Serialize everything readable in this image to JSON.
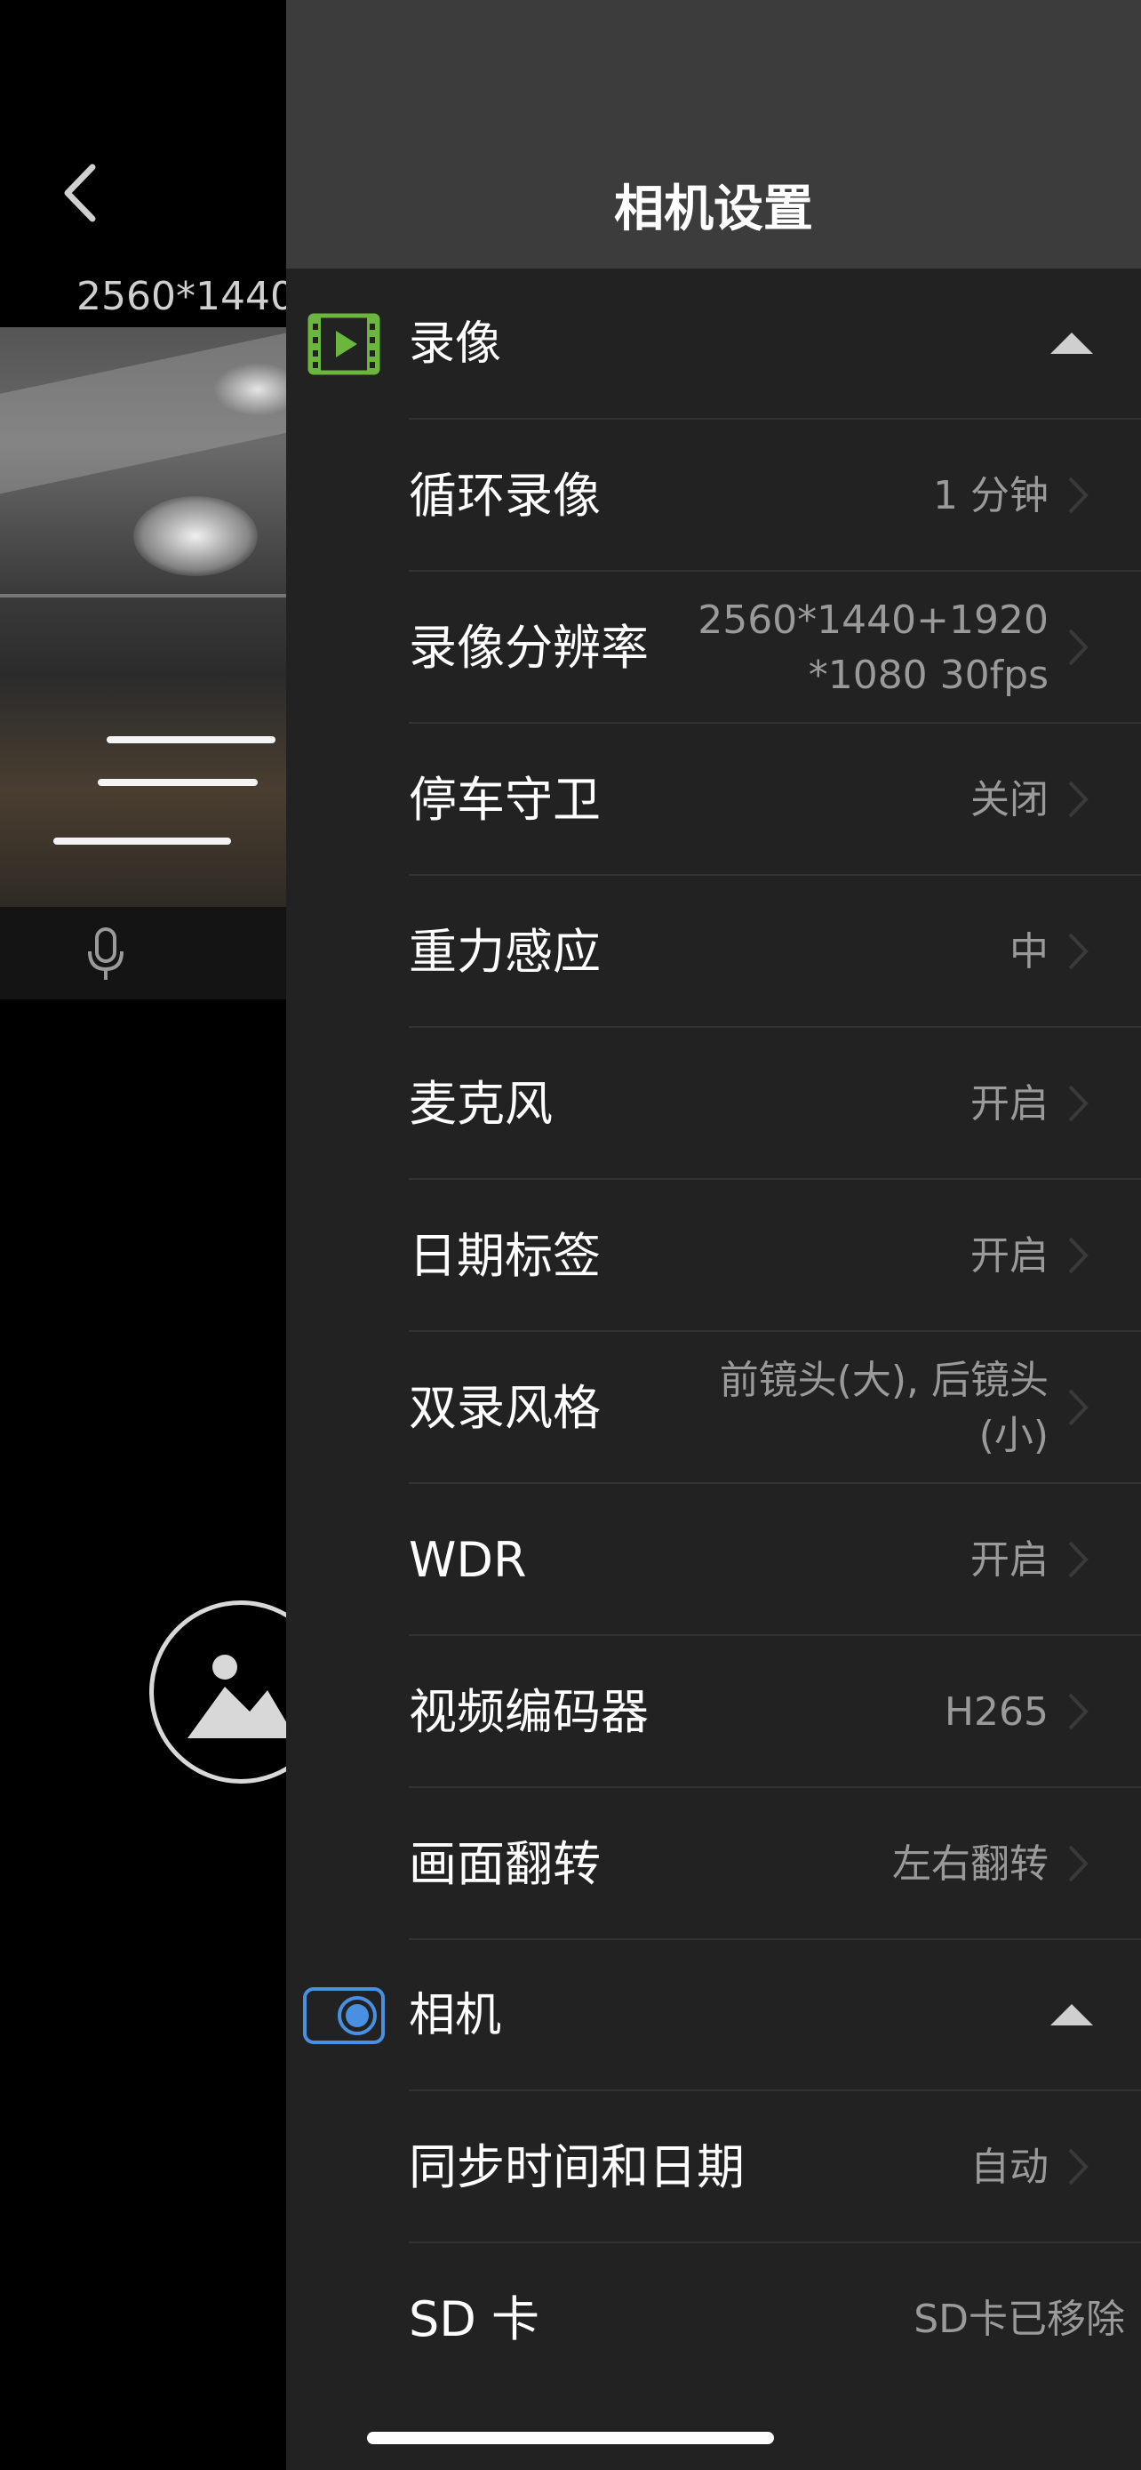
{
  "header": {
    "title": "相机设置"
  },
  "preview": {
    "resolution_label": "2560*1440"
  },
  "icons": {
    "back": "chevron-left-icon",
    "mic": "microphone-icon",
    "gallery": "image-gallery-icon",
    "video": "video-play-icon",
    "camera": "camera-record-icon",
    "chevron": "chevron-right-icon"
  },
  "colors": {
    "video_icon": "#6bb63c",
    "camera_icon": "#4a90e2"
  },
  "sections": {
    "video": {
      "label": "录像",
      "items": [
        {
          "label": "循环录像",
          "value": "1 分钟"
        },
        {
          "label": "录像分辨率",
          "value": "2560*1440+1920 *1080 30fps"
        },
        {
          "label": "停车守卫",
          "value": "关闭"
        },
        {
          "label": "重力感应",
          "value": "中"
        },
        {
          "label": "麦克风",
          "value": "开启"
        },
        {
          "label": "日期标签",
          "value": "开启"
        },
        {
          "label": "双录风格",
          "value": "前镜头(大), 后镜头 (小)"
        },
        {
          "label": "WDR",
          "value": "开启"
        },
        {
          "label": "视频编码器",
          "value": "H265"
        },
        {
          "label": "画面翻转",
          "value": "左右翻转"
        }
      ]
    },
    "camera": {
      "label": "相机",
      "items": [
        {
          "label": "同步时间和日期",
          "value": "自动"
        },
        {
          "label": "SD 卡",
          "value": "SD卡已移除"
        }
      ]
    }
  }
}
